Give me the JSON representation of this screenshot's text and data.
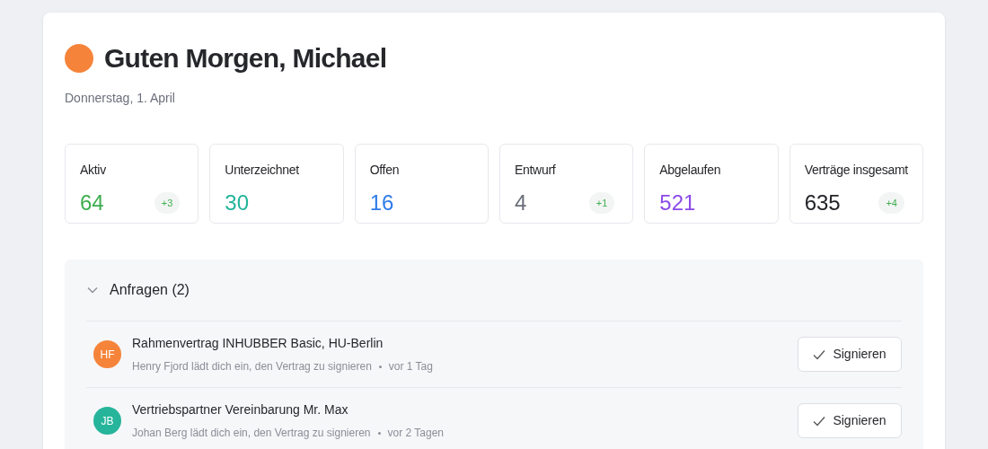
{
  "header": {
    "title": "Guten Morgen, Michael",
    "date": "Donnerstag, 1. April"
  },
  "stats": [
    {
      "label": "Aktiv",
      "value": "64",
      "color": "#3fae4f",
      "badge": "+3"
    },
    {
      "label": "Unterzeichnet",
      "value": "30",
      "color": "#22b39a"
    },
    {
      "label": "Offen",
      "value": "16",
      "color": "#2f7ce8"
    },
    {
      "label": "Entwurf",
      "value": "4",
      "color": "#6b6f7b",
      "badge": "+1"
    },
    {
      "label": "Abgelaufen",
      "value": "521",
      "color": "#8b4ae8"
    },
    {
      "label": "Verträge insgesamt",
      "value": "635",
      "color": "#222428",
      "badge": "+4"
    }
  ],
  "requests": {
    "title": "Anfragen (2)",
    "expanded": true,
    "items": [
      {
        "initials": "HF",
        "color": "#f5843a",
        "title": "Rahmenvertrag INHUBBER Basic, HU-Berlin",
        "subtitle": "Henry Fjord lädt dich ein, den Vertrag zu signieren",
        "time": "vor 1 Tag",
        "action": "Signieren"
      },
      {
        "initials": "JB",
        "color": "#26b59b",
        "title": "Vertriebspartner Vereinbarung Mr. Max",
        "subtitle": "Johan Berg lädt dich ein, den Vertrag zu signieren",
        "time": "vor 2 Tagen",
        "action": "Signieren"
      }
    ]
  }
}
